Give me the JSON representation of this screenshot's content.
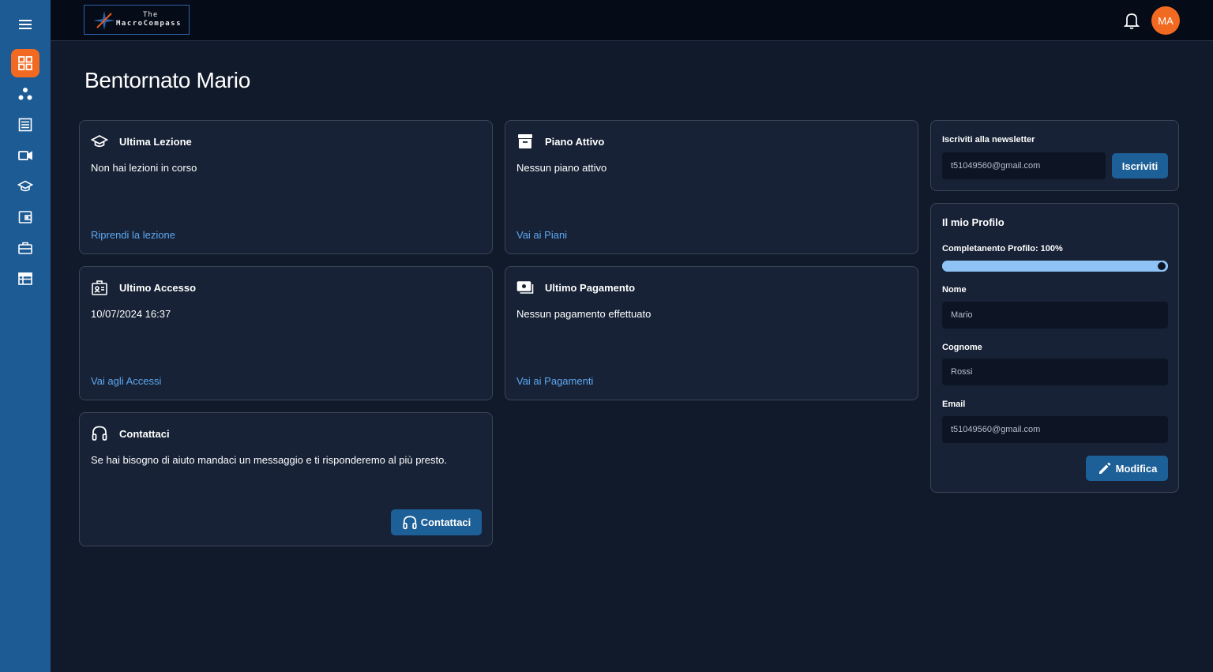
{
  "app": {
    "logo_line1": "The",
    "logo_line2": "MacroCompass"
  },
  "header": {
    "avatar_initials": "MA"
  },
  "sidebar": {
    "items": [
      {
        "icon": "menu-icon"
      },
      {
        "icon": "dashboard-icon",
        "active": true
      },
      {
        "icon": "community-icon"
      },
      {
        "icon": "list-icon"
      },
      {
        "icon": "video-icon"
      },
      {
        "icon": "graduation-cap-icon"
      },
      {
        "icon": "wallet-icon"
      },
      {
        "icon": "briefcase-icon"
      },
      {
        "icon": "calendar-table-icon"
      }
    ]
  },
  "main": {
    "title": "Bentornato Mario",
    "cards": {
      "lesson": {
        "title": "Ultima Lezione",
        "text": "Non hai lezioni in corso",
        "link": "Riprendi la lezione"
      },
      "plan": {
        "title": "Piano Attivo",
        "text": "Nessun piano attivo",
        "link": "Vai ai Piani"
      },
      "access": {
        "title": "Ultimo Accesso",
        "text": "10/07/2024 16:37",
        "link": "Vai agli Accessi"
      },
      "payment": {
        "title": "Ultimo Pagamento",
        "text": "Nessun pagamento effettuato",
        "link": "Vai ai Pagamenti"
      },
      "contact": {
        "title": "Contattaci",
        "text": "Se hai bisogno di aiuto mandaci un messaggio e ti risponderemo al più presto.",
        "button": "Contattaci"
      }
    }
  },
  "newsletter": {
    "label": "Iscriviti alla newsletter",
    "email_value": "t51049560@gmail.com",
    "button": "Iscriviti"
  },
  "profile": {
    "title": "Il mio Profilo",
    "completion_label": "Completanento Profilo: 100%",
    "completion_fraction": 1.0,
    "fields": {
      "name_label": "Nome",
      "name_value": "Mario",
      "surname_label": "Cognome",
      "surname_value": "Rossi",
      "email_label": "Email",
      "email_value": "t51049560@gmail.com"
    },
    "edit_button": "Modifica"
  },
  "colors": {
    "accent": "#f26a21",
    "sidebar": "#1c5b94",
    "link": "#5ea8f0",
    "button": "#1d5f97",
    "progress": "#8fc2f5"
  }
}
